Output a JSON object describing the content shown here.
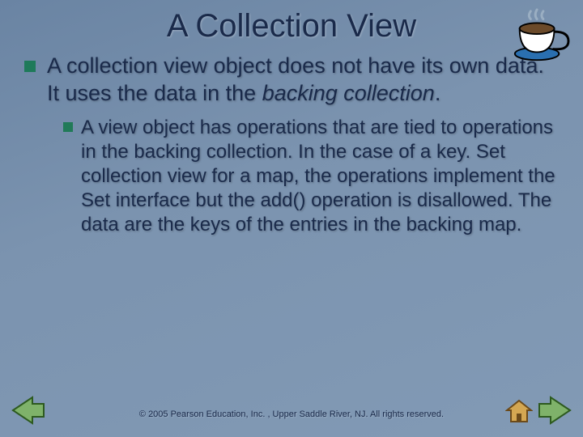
{
  "title": "A Collection View",
  "bullets": {
    "level1": {
      "text_plain": "A collection view object does not have its own data.  It uses the data in the ",
      "italic": "backing collection",
      "trailing": "."
    },
    "level2": {
      "text": "A view object has operations that are tied to operations in the backing collection. In the case of a key. Set collection view for a map, the operations implement the Set interface but the add() operation is disallowed. The data are the keys of the entries in the backing map."
    }
  },
  "footer": "© 2005 Pearson Education, Inc. , Upper Saddle River, NJ.  All rights reserved.",
  "icons": {
    "cup": "coffee-cup",
    "prev": "previous-slide",
    "next": "next-slide",
    "home": "home"
  }
}
